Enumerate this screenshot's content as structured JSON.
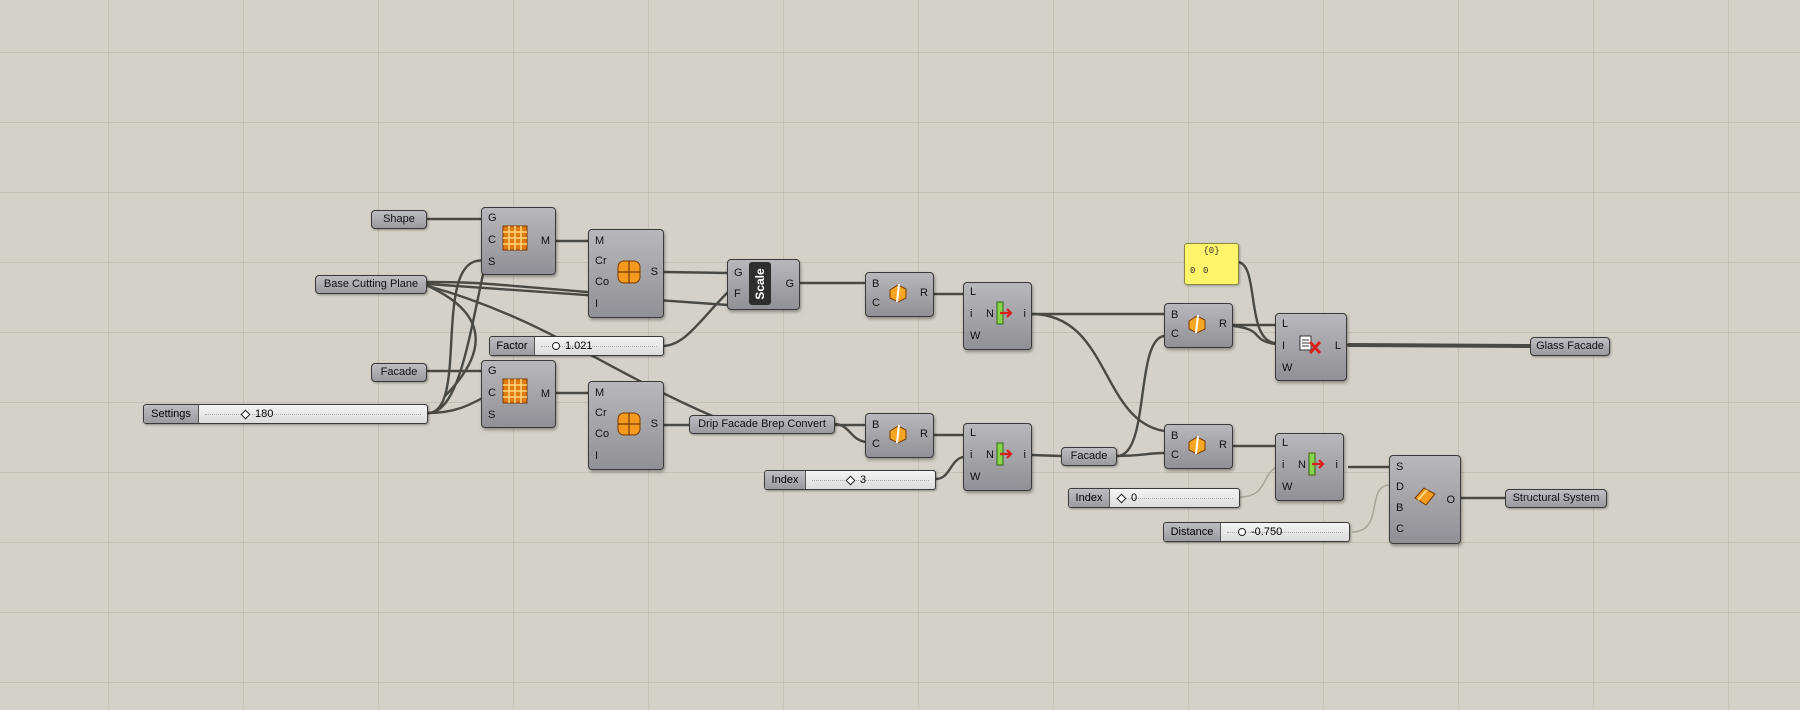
{
  "params": {
    "shape": "Shape",
    "base_cutting_plane": "Base Cutting Plane",
    "facade_a": "Facade",
    "drip_facade": "Drip Facade Brep Convert",
    "facade_b": "Facade",
    "glass_facade": "Glass Facade",
    "structural_system": "Structural System"
  },
  "sliders": {
    "settings": {
      "label": "Settings",
      "value": "180"
    },
    "factor": {
      "label": "Factor",
      "value": "1.021"
    },
    "index_1": {
      "label": "Index",
      "value": "3"
    },
    "index_2": {
      "label": "Index",
      "value": "0"
    },
    "distance": {
      "label": "Distance",
      "value": "-0.750"
    }
  },
  "panel": {
    "path": "{0}",
    "index": "0",
    "value": "0"
  },
  "components": {
    "grid_1": {
      "inputs": [
        "G",
        "C",
        "S"
      ],
      "outputs": [
        "M"
      ]
    },
    "grid_2": {
      "inputs": [
        "G",
        "C",
        "S"
      ],
      "outputs": [
        "M"
      ]
    },
    "surf_1": {
      "inputs": [
        "M",
        "Cr",
        "Co",
        "I"
      ],
      "outputs": [
        "S"
      ]
    },
    "surf_2": {
      "inputs": [
        "M",
        "Cr",
        "Co",
        "I"
      ],
      "outputs": [
        "S"
      ]
    },
    "scale": {
      "inputs": [
        "G",
        "F"
      ],
      "outputs": [
        "G"
      ],
      "label": "Scale"
    },
    "split_1": {
      "inputs": [
        "B",
        "C"
      ],
      "outputs": [
        "R"
      ]
    },
    "split_2": {
      "inputs": [
        "B",
        "C"
      ],
      "outputs": [
        "R"
      ]
    },
    "split_3": {
      "inputs": [
        "B",
        "C"
      ],
      "outputs": [
        "R"
      ]
    },
    "split_4": {
      "inputs": [
        "B",
        "C"
      ],
      "outputs": [
        "R"
      ]
    },
    "item_1": {
      "inputs": [
        "L",
        "i",
        "W"
      ],
      "outputs": [
        "i"
      ],
      "center": "N"
    },
    "item_2": {
      "inputs": [
        "L",
        "i",
        "W"
      ],
      "outputs": [
        "i"
      ],
      "center": "N"
    },
    "item_3": {
      "inputs": [
        "L",
        "i",
        "W"
      ],
      "outputs": [
        "i"
      ],
      "center": "N"
    },
    "cull": {
      "inputs": [
        "L",
        "I",
        "W"
      ],
      "outputs": [
        "L"
      ]
    },
    "offset": {
      "inputs": [
        "S",
        "D",
        "B",
        "C"
      ],
      "outputs": [
        "O"
      ]
    }
  },
  "colors": {
    "canvas": "#d4d2c8",
    "component": "#a5a5aa",
    "wire": "#4a4a44",
    "panel": "#fff46a"
  }
}
